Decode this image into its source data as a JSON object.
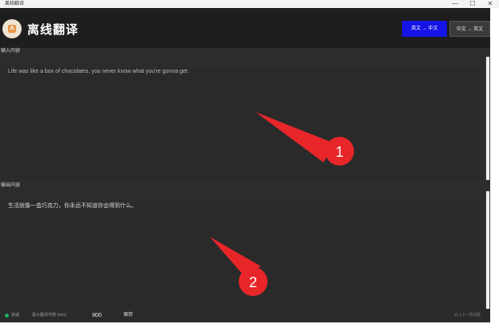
{
  "window": {
    "title": "离线翻译",
    "controls": {
      "minimize": "—",
      "maximize": "☐",
      "close": "✕"
    }
  },
  "header": {
    "logo_letter": "A",
    "title": "离线翻译",
    "direction_buttons": [
      {
        "label": "英文 → 中文",
        "active": true
      },
      {
        "label": "中文 → 英文",
        "active": false
      }
    ]
  },
  "input_section": {
    "label": "输入内容",
    "value": "Life was like a box of chocolates, you never know what you're gonna get."
  },
  "output_section": {
    "label": "输出内容",
    "value": "生活就像一盒巧克力，你永远不知道你会得到什么。"
  },
  "annotations": {
    "markers": [
      "1",
      "2"
    ],
    "color": "#e8262a"
  },
  "statusbar": {
    "status_text": "就绪",
    "max_chars_label": "最大翻译字数 (min)",
    "max_chars_value": "800",
    "save_label": "保存",
    "version": "v0.1.2 • 测试版"
  },
  "colors": {
    "app_bg": "#2c2c2c",
    "header_bg": "#1e1e1e",
    "accent_blue": "#1414e6",
    "status_green": "#17b55a",
    "annotation_red": "#e8262a"
  }
}
